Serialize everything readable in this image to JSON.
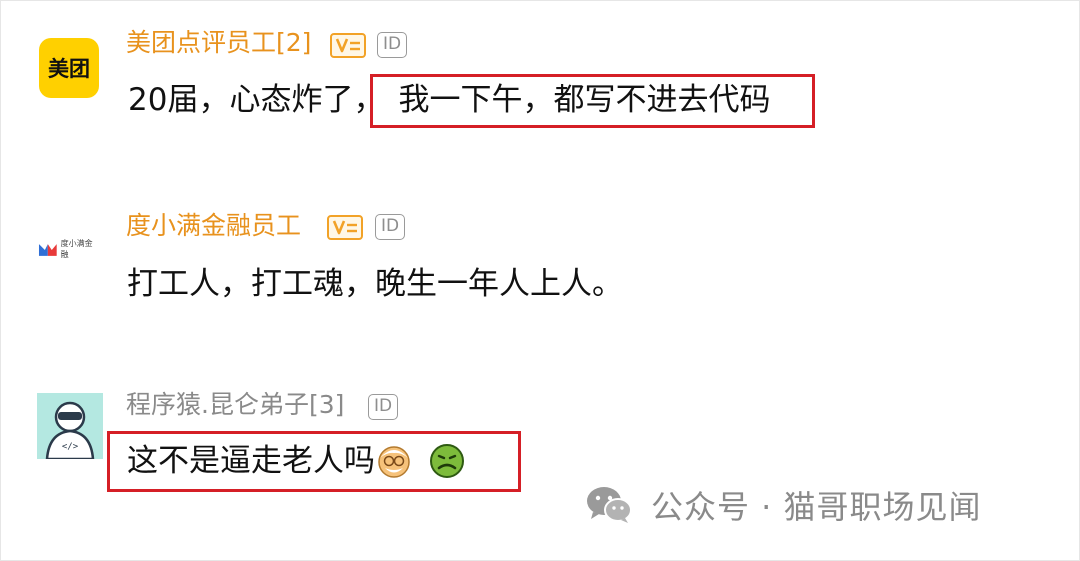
{
  "comments": [
    {
      "avatar_text": "美团",
      "username": "美团点评员工[2]",
      "id_badge": "ID",
      "text_before": "20届，心态炸了，",
      "text_highlight": "我一下午，都写不进去代码"
    },
    {
      "avatar_text": "度小满金融",
      "username": "度小满金融员工",
      "id_badge": "ID",
      "text": "打工人，打工魂，晚生一年人上人。"
    },
    {
      "username": "程序猿.昆仑弟子[3]",
      "id_badge": "ID",
      "text": "这不是逼走老人吗"
    }
  ],
  "watermark": {
    "text": "公众号 · 猫哥职场见闻",
    "icon": "wechat-icon"
  },
  "colors": {
    "brand_username": "#e8921d",
    "muted_username": "#8a8a8a",
    "highlight_border": "#d51f26",
    "meituan_yellow": "#ffd000"
  }
}
